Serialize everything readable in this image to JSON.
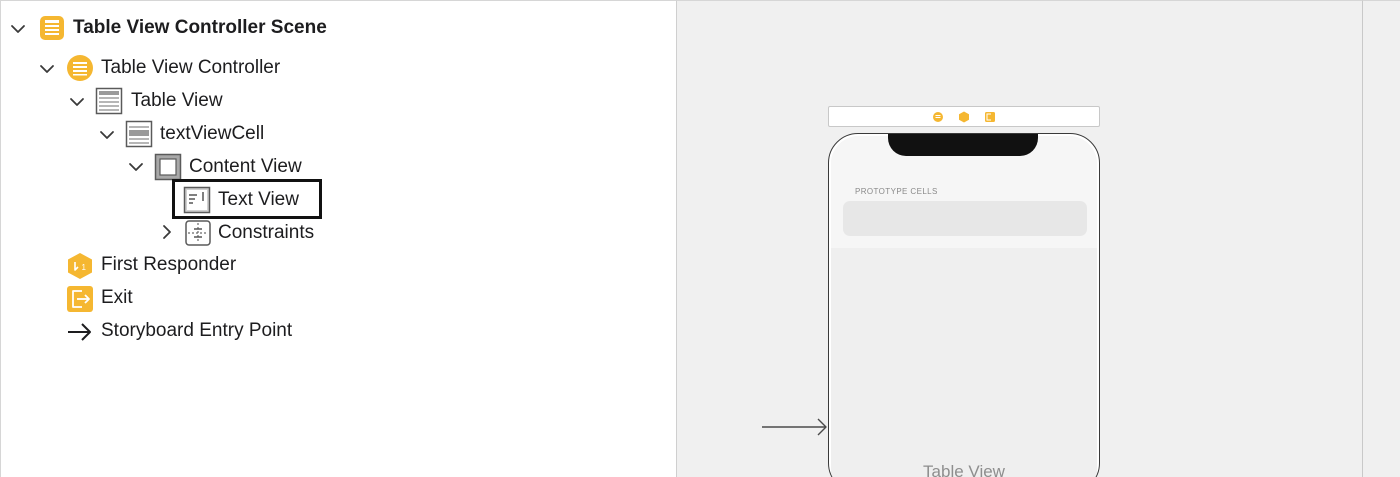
{
  "outline": {
    "scene": {
      "label": "Table View Controller Scene",
      "icon": "scene-icon"
    },
    "items": [
      {
        "label": "Table View Controller",
        "icon": "table-view-controller-icon",
        "expanded": true
      },
      {
        "label": "Table View",
        "icon": "table-view-icon",
        "expanded": true
      },
      {
        "label": "textViewCell",
        "icon": "table-view-cell-icon",
        "expanded": true
      },
      {
        "label": "Content View",
        "icon": "content-view-icon",
        "expanded": true
      },
      {
        "label": "Text View",
        "icon": "text-view-icon",
        "selected": true
      },
      {
        "label": "Constraints",
        "icon": "constraints-icon",
        "expanded": false
      },
      {
        "label": "First Responder",
        "icon": "first-responder-icon"
      },
      {
        "label": "Exit",
        "icon": "exit-icon"
      },
      {
        "label": "Storyboard Entry Point",
        "icon": "entry-point-arrow-icon"
      }
    ]
  },
  "canvas": {
    "prototype_cells_label": "PROTOTYPE CELLS",
    "table_view_label": "Table View",
    "dock_icons": [
      "view-controller-dock-icon",
      "first-responder-dock-icon",
      "exit-dock-icon"
    ]
  },
  "colors": {
    "accent_orange": "#f5b731",
    "outline_text": "#1d1d1f",
    "canvas_bg": "#f0f0f0",
    "selection_box": "#111111"
  }
}
